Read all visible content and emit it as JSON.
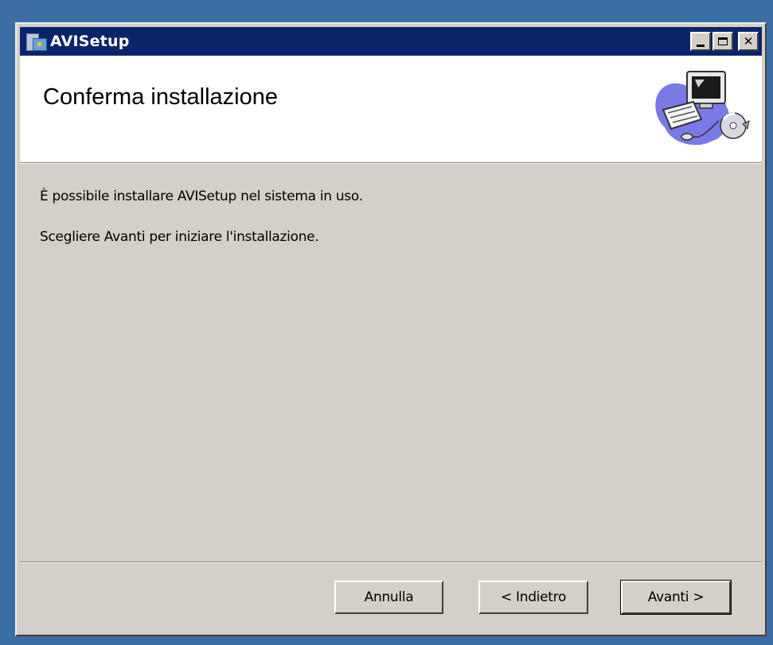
{
  "window": {
    "title": "AVISetup",
    "controls": {
      "minimize": "minimize",
      "maximize": "maximize",
      "close": "✕"
    }
  },
  "header": {
    "title": "Conferma installazione",
    "graphic": "computer-with-cd-icon"
  },
  "body": {
    "line1": "È possibile installare AVISetup nel sistema in uso.",
    "line2": "Scegliere Avanti per iniziare l'installazione."
  },
  "buttons": {
    "cancel": "Annulla",
    "back": "< Indietro",
    "next": "Avanti >"
  },
  "colors": {
    "titlebar": "#0a246a",
    "dialog_face": "#d4d0c8",
    "desktop": "#3a6ea5"
  }
}
